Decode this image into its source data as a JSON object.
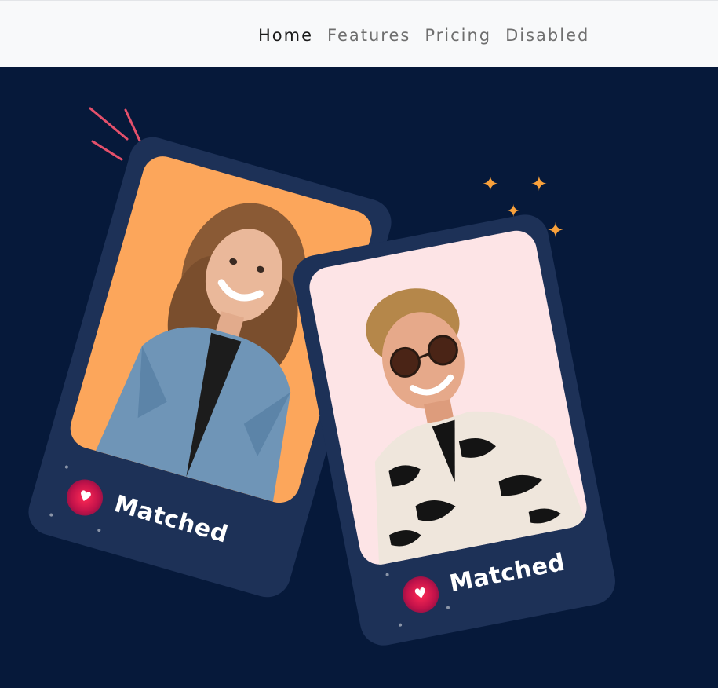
{
  "nav": {
    "items": [
      {
        "label": "Home",
        "state": "active"
      },
      {
        "label": "Features",
        "state": "default"
      },
      {
        "label": "Pricing",
        "state": "default"
      },
      {
        "label": "Disabled",
        "state": "disabled"
      }
    ]
  },
  "hero": {
    "background_color": "#06193a",
    "cards": [
      {
        "label": "Matched",
        "photo_background": "#fca65b",
        "photo": "woman-in-denim-jacket"
      },
      {
        "label": "Matched",
        "photo_background": "#fde4e6",
        "photo": "man-in-sunglasses-patterned-shirt"
      }
    ],
    "icons": {
      "sparkles": "sparkle-icon",
      "burst": "burst-lines-icon",
      "heart": "heart-icon"
    },
    "accent_colors": {
      "card": "#1d3157",
      "heart": "#ff2a55",
      "sparkle": "#f9a13b",
      "burst": "#e4506b"
    }
  }
}
